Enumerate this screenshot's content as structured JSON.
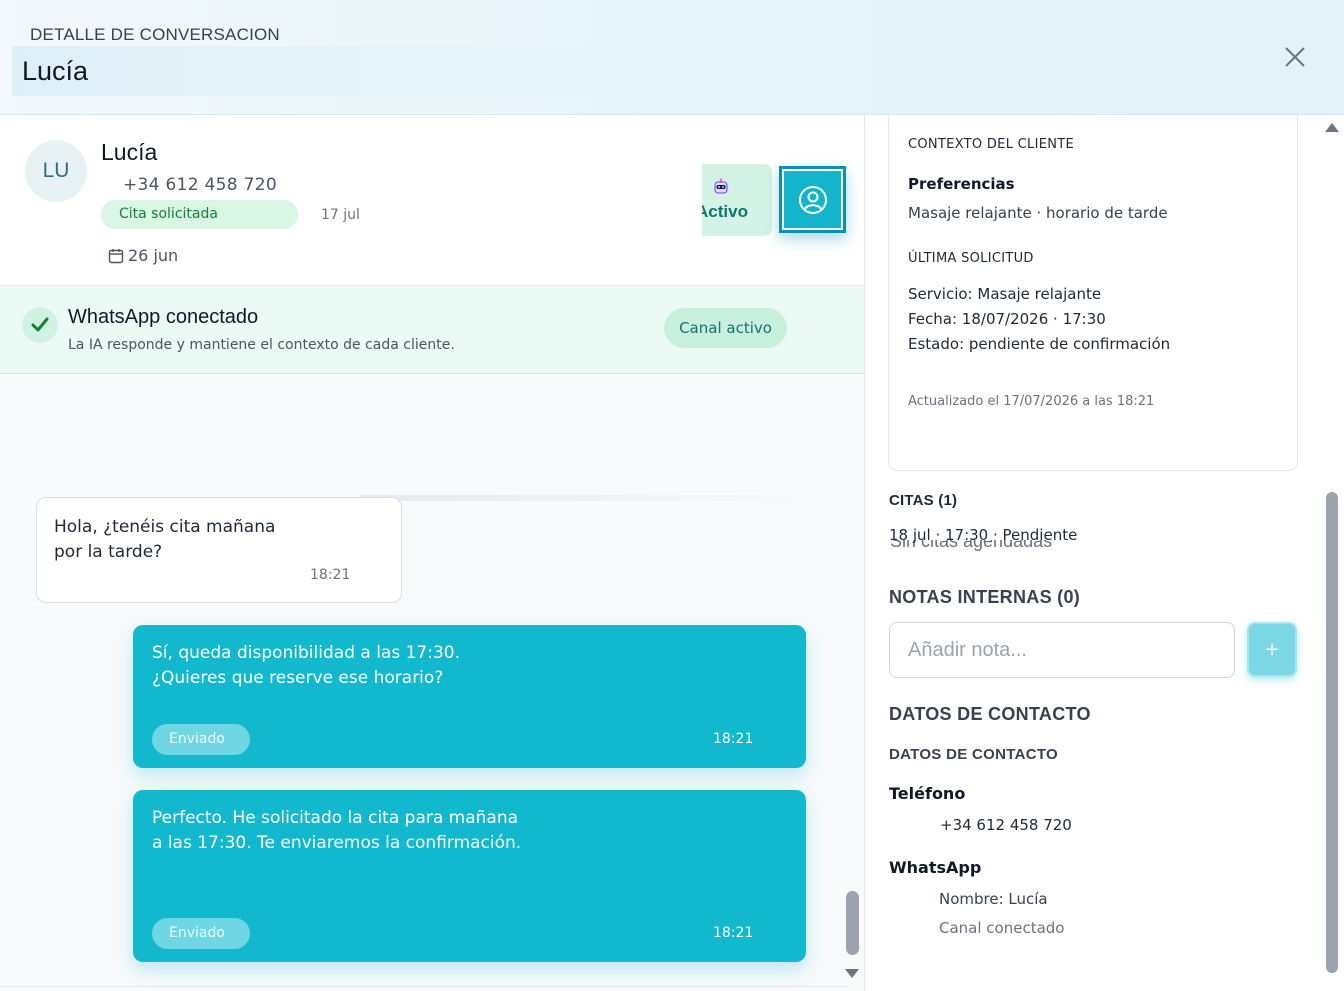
{
  "header": {
    "subtitle": "DETALLE DE CONVERSACION",
    "title": "Lucía"
  },
  "contact": {
    "initials": "LU",
    "name": "Lucía",
    "phone": "+34 612 458 720",
    "status": "Cita solicitada",
    "date": "17 jul",
    "calendar_date": "26 jun",
    "bot_label": "Activo"
  },
  "whatsapp": {
    "title": "WhatsApp conectado",
    "subtitle": "La IA responde y mantiene el contexto de cada cliente.",
    "pill": "Canal activo"
  },
  "messages": [
    {
      "direction": "in",
      "text": "Hola, ¿tenéis cita mañana por la tarde?",
      "time": "18:21"
    },
    {
      "direction": "out",
      "text": "Sí, queda disponibilidad a las 17:30. ¿Quieres que reserve ese horario?",
      "badge": "Enviado",
      "time": "18:21"
    },
    {
      "direction": "out",
      "text": "Perfecto. He solicitado la cita para mañana a las 17:30. Te enviaremos la confirmación.",
      "badge": "Enviado",
      "time": "18:21"
    }
  ],
  "context": {
    "heading": "CONTEXTO DEL CLIENTE",
    "preferences_heading": "Preferencias",
    "preferences": "Masaje relajante · horario de tarde",
    "last_request_heading": "ÚLTIMA SOLICITUD",
    "service": "Servicio: Masaje relajante",
    "date": "Fecha: 18/07/2026 · 17:30",
    "state": "Estado: pendiente de confirmación",
    "updated": "Actualizado el 17/07/2026 a las 18:21"
  },
  "citas": {
    "heading": "CITAS (1)",
    "ghost": "Sin citas agendadas",
    "item": "18 jul · 17:30 · Pendiente"
  },
  "notes": {
    "heading": "NOTAS INTERNAS (0)",
    "placeholder": "Añadir nota...",
    "add_label": "+"
  },
  "contact_data": {
    "heading": "DATOS DE CONTACTO",
    "subheading": "DATOS DE CONTACTO",
    "phone_label": "Teléfono",
    "phone_value": "+34 612 458 720",
    "whatsapp_label": "WhatsApp",
    "whatsapp_name": "Nombre: Lucía",
    "whatsapp_channel": "Canal conectado"
  },
  "colors": {
    "accent": "#12b8ce",
    "success": "#15803d",
    "success_bg": "#d9f7e4"
  }
}
